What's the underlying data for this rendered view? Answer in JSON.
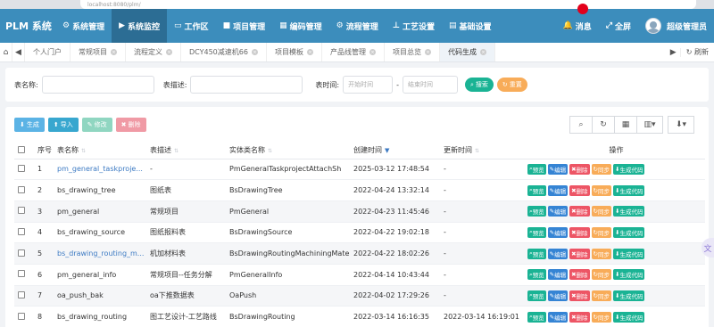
{
  "browser": {
    "url": "localhost:8080/plm/"
  },
  "brand": "PLM 系统",
  "menu": [
    {
      "icon": "⚙",
      "label": "系统管理",
      "active": false
    },
    {
      "icon": "▶",
      "label": "系统监控",
      "active": true
    },
    {
      "icon": "▭",
      "label": "工作区",
      "active": false
    },
    {
      "icon": "■",
      "label": "项目管理",
      "active": false
    },
    {
      "icon": "▦",
      "label": "编码管理",
      "active": false
    },
    {
      "icon": "⚙",
      "label": "流程管理",
      "active": false
    },
    {
      "icon": "⊥",
      "label": "工艺设置",
      "active": false
    },
    {
      "icon": "▤",
      "label": "基础设置",
      "active": false
    }
  ],
  "right_menu": {
    "message_label": "消息",
    "fullscreen_label": "全屏",
    "user_label": "超级管理员"
  },
  "tabs": [
    {
      "label": "个人门户",
      "closable": false,
      "active": false
    },
    {
      "label": "常规项目",
      "closable": true,
      "active": false
    },
    {
      "label": "流程定义",
      "closable": true,
      "active": false
    },
    {
      "label": "DCY450减速机66",
      "closable": true,
      "active": false
    },
    {
      "label": "项目模板",
      "closable": true,
      "active": false
    },
    {
      "label": "产品线管理",
      "closable": true,
      "active": false
    },
    {
      "label": "项目总览",
      "closable": true,
      "active": false
    },
    {
      "label": "代码生成",
      "closable": true,
      "active": true
    }
  ],
  "tabs_right": {
    "refresh_label": "刷新"
  },
  "search": {
    "table_name_label": "表名称:",
    "table_desc_label": "表描述:",
    "table_time_label": "表时间:",
    "start_placeholder": "开始时间",
    "end_placeholder": "结束时间",
    "range_sep": "-",
    "search_button": "搜索",
    "reset_button": "重置"
  },
  "toolbar": {
    "generate": "生成",
    "import": "导入",
    "edit": "修改",
    "delete": "删除"
  },
  "columns": {
    "seq": "序号",
    "name": "表名称",
    "desc": "表描述",
    "entity": "实体类名称",
    "created": "创建时间",
    "updated": "更新时间",
    "ops": "操作"
  },
  "op_labels": {
    "preview": "预览",
    "edit": "编辑",
    "delete": "删除",
    "sync": "同步",
    "gen": "生成代码"
  },
  "rows": [
    {
      "seq": "1",
      "name": "pm_general_taskproje...",
      "link": true,
      "desc": "-",
      "entity": "PmGeneralTaskprojectAttachSh",
      "created": "2025-03-12 17:48:54",
      "updated": "-"
    },
    {
      "seq": "2",
      "name": "bs_drawing_tree",
      "link": false,
      "desc": "图纸表",
      "entity": "BsDrawingTree",
      "created": "2022-04-24 13:32:14",
      "updated": "-"
    },
    {
      "seq": "3",
      "name": "pm_general",
      "link": false,
      "desc": "常规项目",
      "entity": "PmGeneral",
      "created": "2022-04-23 11:45:46",
      "updated": "-"
    },
    {
      "seq": "4",
      "name": "bs_drawing_source",
      "link": false,
      "desc": "图纸报料表",
      "entity": "BsDrawingSource",
      "created": "2022-04-22 19:02:18",
      "updated": "-"
    },
    {
      "seq": "5",
      "name": "bs_drawing_routing_m...",
      "link": true,
      "desc": "机加材料表",
      "entity": "BsDrawingRoutingMachiningMaterial",
      "created": "2022-04-22 18:02:26",
      "updated": "-"
    },
    {
      "seq": "6",
      "name": "pm_general_info",
      "link": false,
      "desc": "常规项目--任务分解",
      "entity": "PmGeneralInfo",
      "created": "2022-04-14 10:43:44",
      "updated": "-"
    },
    {
      "seq": "7",
      "name": "oa_push_bak",
      "link": false,
      "desc": "oa下推数据表",
      "entity": "OaPush",
      "created": "2022-04-02 17:29:26",
      "updated": "-"
    },
    {
      "seq": "8",
      "name": "bs_drawing_routing",
      "link": false,
      "desc": "图工艺设计-工艺路线",
      "entity": "BsDrawingRouting",
      "created": "2022-03-14 16:16:35",
      "updated": "2022-03-14 16:19:01"
    }
  ],
  "colors": {
    "topnav": "#3c8dbc",
    "preview": "#1ab394",
    "edit": "#3584d4",
    "delete": "#ed5565",
    "sync": "#f8ac59",
    "gen": "#1ab394",
    "generate_btn": "#5bb3e5",
    "import_btn": "#38a7cf",
    "edit_btn": "#90d6c1",
    "delete_btn": "#f09aa5",
    "search_btn": "#1ab394",
    "reset_btn": "#f8ac59"
  }
}
